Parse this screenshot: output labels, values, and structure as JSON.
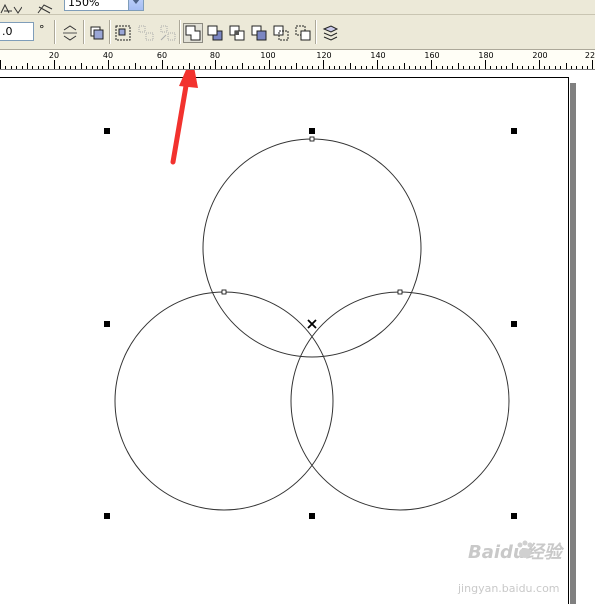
{
  "zoom": {
    "value": "150%"
  },
  "rotation": {
    "value": ".0",
    "unit": "°"
  },
  "ruler": {
    "labels": [
      "20",
      "40",
      "60",
      "80",
      "100",
      "120",
      "140",
      "160",
      "180",
      "200",
      "22"
    ]
  },
  "toolbar": {
    "buttons": [
      "convert-to-curves",
      "combine",
      "group",
      "ungroup",
      "ungroup-all",
      "weld",
      "trim",
      "intersect",
      "simplify",
      "front-minus-back",
      "back-minus-front",
      "create-boundary"
    ],
    "highlighted_button": "weld"
  },
  "canvas": {
    "shapes": [
      "circle-top",
      "circle-left",
      "circle-right"
    ],
    "selection": "all-three-circles-selected",
    "annotation": "red-arrow-pointing-to-weld-button"
  },
  "colors": {
    "arrow": "#f2322e",
    "outline": "#333333",
    "handle": "#000000"
  },
  "watermark": {
    "text": "Baidu经验",
    "sub": "jingyan.baidu.com"
  }
}
